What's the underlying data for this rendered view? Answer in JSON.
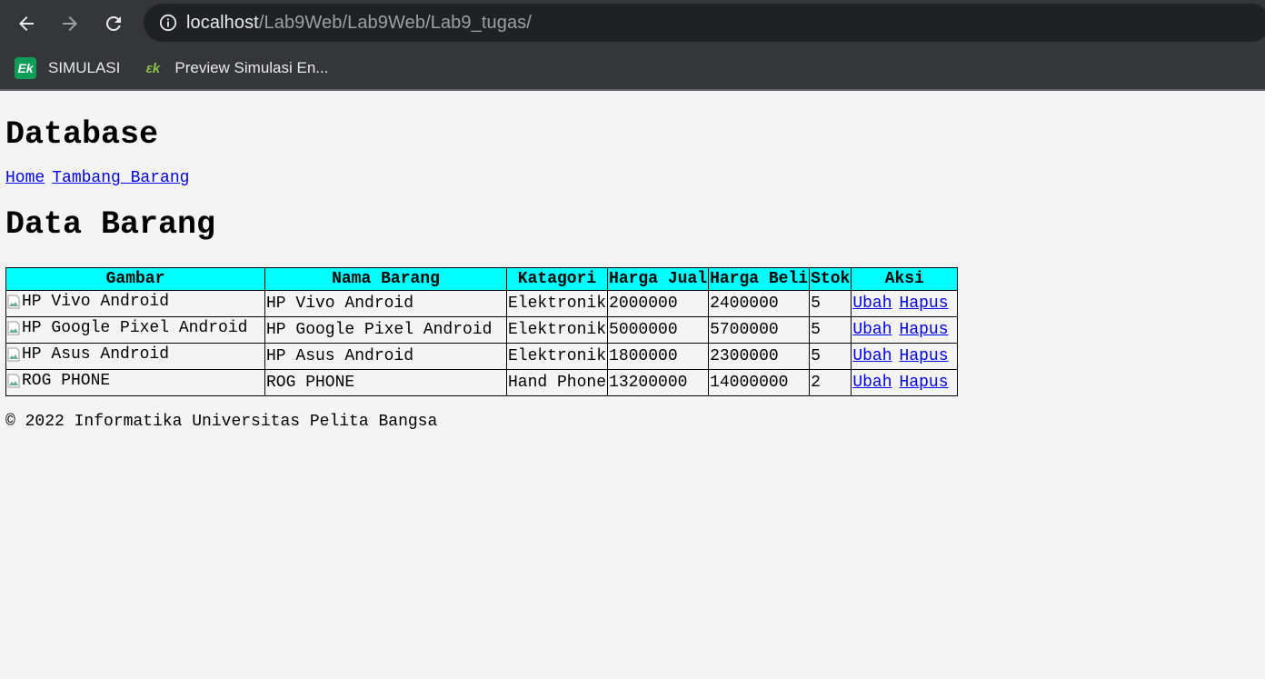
{
  "browser": {
    "url_host": "localhost",
    "url_path": "/Lab9Web/Lab9Web/Lab9_tugas/",
    "bookmarks": [
      {
        "label": "SIMULASI",
        "icon": "ek-logo-icon"
      },
      {
        "label": "Preview Simulasi En...",
        "icon": "ek-leaf-logo-icon"
      }
    ]
  },
  "page": {
    "heading": "Database",
    "nav": {
      "home": "Home",
      "add": "Tambang Barang"
    },
    "subheading": "Data Barang",
    "table": {
      "headers": [
        "Gambar",
        "Nama Barang",
        "Katagori",
        "Harga Jual",
        "Harga Beli",
        "Stok",
        "Aksi"
      ],
      "rows": [
        {
          "img_alt": "HP Vivo Android",
          "name": "HP Vivo Android",
          "category": "Elektronik",
          "sell": "2000000",
          "buy": "2400000",
          "stock": "5",
          "edit": "Ubah",
          "delete": "Hapus"
        },
        {
          "img_alt": "HP Google Pixel Android",
          "name": "HP Google Pixel Android",
          "category": "Elektronik",
          "sell": "5000000",
          "buy": "5700000",
          "stock": "5",
          "edit": "Ubah",
          "delete": "Hapus"
        },
        {
          "img_alt": "HP Asus Android",
          "name": "HP Asus Android",
          "category": "Elektronik",
          "sell": "1800000",
          "buy": "2300000",
          "stock": "5",
          "edit": "Ubah",
          "delete": "Hapus"
        },
        {
          "img_alt": "ROG PHONE",
          "name": "ROG PHONE",
          "category": "Hand Phone",
          "sell": "13200000",
          "buy": "14000000",
          "stock": "2",
          "edit": "Ubah",
          "delete": "Hapus"
        }
      ]
    },
    "footer": "© 2022 Informatika Universitas Pelita Bangsa"
  },
  "colors": {
    "header_bg": "#00ffff",
    "link": "#0000ee",
    "chrome_bg": "#35363a"
  }
}
